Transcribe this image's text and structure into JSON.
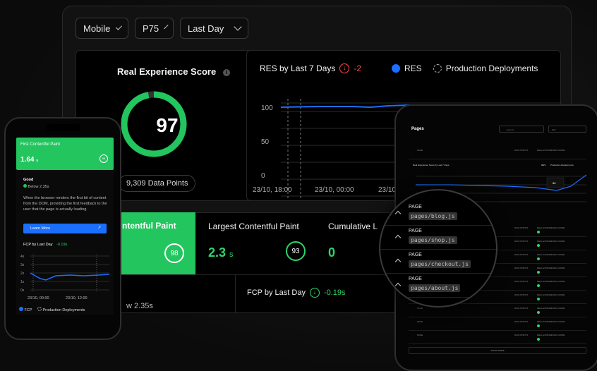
{
  "filters": {
    "device": "Mobile",
    "percentile": "P75",
    "range": "Last Day"
  },
  "score": {
    "title": "Real Experience Score",
    "value": "97",
    "info": "i",
    "data_points": "9,309 Data Points",
    "progress": 0.97
  },
  "res_chart": {
    "title": "RES by Last 7 Days",
    "change": "-2",
    "legend_res": "RES",
    "legend_deploy": "Production Deployments",
    "y_ticks": [
      "100",
      "50",
      "0"
    ],
    "x_ticks": [
      "23/10, 18:00",
      "23/10, 00:00",
      "23/10"
    ]
  },
  "metrics": {
    "fcp": {
      "label": "ntentful Paint",
      "ring": "98"
    },
    "lcp": {
      "label": "Largest Contentful Paint",
      "value": "2.3",
      "unit": "s",
      "ring": "93"
    },
    "cls": {
      "label": "Cumulative L",
      "value": "0"
    }
  },
  "bottom": {
    "left_text": "w 2.35s",
    "fcp_title": "FCP by Last Day",
    "fcp_change": "-0.19s"
  },
  "phone": {
    "title": "First Contentful Paint",
    "value": "1.64",
    "unit": "s",
    "ring": "98",
    "status": "Good",
    "threshold": "Below 2.35s",
    "description": "When the browser renders the first bit of content from the DOM, providing the first feedback to the user that the page is actually loading.",
    "learn_more": "Learn More",
    "chart_title": "FCP by Last Day",
    "chart_change": "-0.19s",
    "y_ticks": [
      "4s",
      "3s",
      "2s",
      "1s",
      "0s"
    ],
    "x_ticks": [
      "23/10, 00:00",
      "23/10, 12:00"
    ],
    "legend_fcp": "FCP",
    "legend_deploy": "Production Deployments"
  },
  "tablet": {
    "title": "Pages",
    "search_placeholder": "Search...",
    "sort": "Sort",
    "chart_title": "Real Experience Score by Last 7 Days",
    "legend_res": "RES",
    "legend_deploy": "Production Deployments",
    "tooltip_value": "86",
    "show_more": "SHOW MORE",
    "row_page": "PAGE",
    "row_points": "DATA POINTS",
    "row_res": "REAL EXPERIENCE SCORE",
    "row_trend": "TREND"
  },
  "magnifier": {
    "label": "PAGE",
    "pages": [
      "pages/blog.js",
      "pages/shop.js",
      "pages/checkout.js",
      "pages/about.js"
    ]
  }
}
